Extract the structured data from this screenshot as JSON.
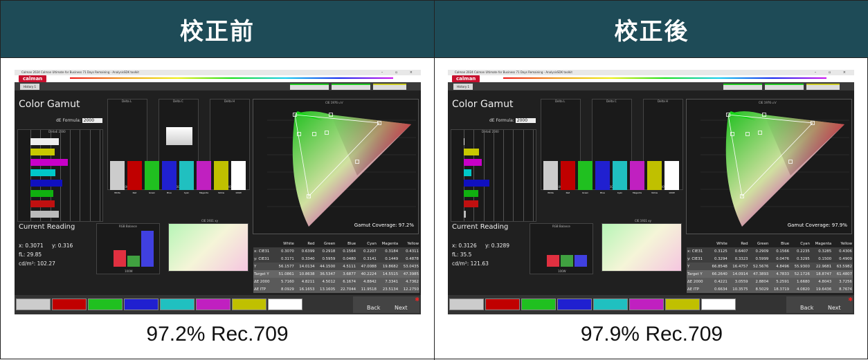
{
  "panels": [
    {
      "id": "before",
      "header": "校正前",
      "caption": "97.2% Rec.709",
      "window_title": "Calman 2024 Calman Ultimate for Business 71 Days Remaining - AnalysisSDK toolkit",
      "app_logo": "calman",
      "tab_label": "History 1",
      "title": "Color Gamut",
      "de_formula_label": "dE Formula:",
      "de_formula_value": "2000",
      "deltae_label": "DeltaE 2000",
      "delta_titles": [
        "Delta L",
        "Delta C",
        "Delta H"
      ],
      "delta_footer": "100W",
      "cie_title": "CIE 1976 u'v'",
      "gamut_coverage": "Gamut Coverage: 97.2%",
      "patch_labels": [
        "White",
        "Red",
        "Green",
        "Blue",
        "Cyan",
        "Magenta",
        "Yellow",
        "100W"
      ],
      "current_reading": "Current Reading",
      "x_label": "x: 0.3071",
      "y_label": "y: 0.316",
      "fl_label": "fL: 29.85",
      "cdm_label": "cd/m²: 102.27",
      "rgb_balance_title": "RGB Balance",
      "cie31_title": "CIE 1931 xy",
      "rgb_balance": {
        "r": 108,
        "g": 98,
        "b": 140,
        "ymin": 80,
        "ymax": 140
      },
      "table": {
        "header": [
          "",
          "White",
          "Red",
          "Green",
          "Blue",
          "Cyan",
          "Magenta",
          "Yellow"
        ],
        "rows": [
          [
            "x: CIE31",
            "0.3070",
            "0.6399",
            "0.2918",
            "0.1564",
            "0.2207",
            "0.3184",
            "0.4311"
          ],
          [
            "y: CIE31",
            "0.3171",
            "0.3340",
            "0.5959",
            "0.0480",
            "0.3141",
            "0.1449",
            "0.4878"
          ],
          [
            "Y",
            "56.1577",
            "14.0134",
            "44.1500",
            "4.5111",
            "47.0088",
            "19.8682",
            "53.0435"
          ],
          [
            "Target Y",
            "51.0861",
            "10.8638",
            "36.5347",
            "3.6877",
            "40.2224",
            "14.5515",
            "47.3985"
          ],
          [
            "ΔE 2000",
            "5.7160",
            "4.8211",
            "4.5012",
            "6.1674",
            "4.8842",
            "7.3341",
            "4.7362"
          ],
          [
            "ΔE ITP",
            "8.0929",
            "16.1653",
            "13.1605",
            "22.7044",
            "11.9518",
            "23.5134",
            "12.2750"
          ]
        ]
      },
      "deltae_bars": [
        {
          "v": 5.8,
          "color": "#eeeeee"
        },
        {
          "v": 4.9,
          "color": "#c8c800"
        },
        {
          "v": 7.6,
          "color": "#c800c8"
        },
        {
          "v": 5.1,
          "color": "#00c8c8"
        },
        {
          "v": 6.4,
          "color": "#1010c0"
        },
        {
          "v": 4.6,
          "color": "#10b010"
        },
        {
          "v": 4.9,
          "color": "#c01010"
        },
        {
          "v": 5.7,
          "color": "#bbbbbb"
        }
      ],
      "nav_back": "Back",
      "nav_next": "Next"
    },
    {
      "id": "after",
      "header": "校正後",
      "caption": "97.9% Rec.709",
      "window_title": "Calman 2024 Calman Ultimate for Business 71 Days Remaining - AnalysisSDK toolkit",
      "app_logo": "calman",
      "tab_label": "History 1",
      "title": "Color Gamut",
      "de_formula_label": "dE Formula:",
      "de_formula_value": "2000",
      "deltae_label": "DeltaE 2000",
      "delta_titles": [
        "Delta L",
        "Delta C",
        "Delta H"
      ],
      "delta_footer": "100W",
      "cie_title": "CIE 1976 u'v'",
      "gamut_coverage": "Gamut Coverage: 97.9%",
      "patch_labels": [
        "White",
        "Red",
        "Green",
        "Blue",
        "Cyan",
        "Magenta",
        "Yellow",
        "100W"
      ],
      "current_reading": "Current Reading",
      "x_label": "x: 0.3126",
      "y_label": "y: 0.3289",
      "fl_label": "fL: 35.5",
      "cdm_label": "cd/m²: 121.63",
      "rgb_balance_title": "RGB Balance",
      "cie31_title": "CIE 1931 xy",
      "rgb_balance": {
        "r": 100,
        "g": 100,
        "b": 100,
        "ymin": 80,
        "ymax": 140
      },
      "table": {
        "header": [
          "",
          "White",
          "Red",
          "Green",
          "Blue",
          "Cyan",
          "Magenta",
          "Yellow"
        ],
        "rows": [
          [
            "x: CIE31",
            "0.3125",
            "0.6407",
            "0.2909",
            "0.1566",
            "0.2235",
            "0.3285",
            "0.4306"
          ],
          [
            "y: CIE31",
            "0.3294",
            "0.3323",
            "0.5999",
            "0.0476",
            "0.3295",
            "0.1500",
            "0.4909"
          ],
          [
            "Y",
            "66.8548",
            "16.4757",
            "52.5676",
            "4.8496",
            "55.9300",
            "22.9681",
            "63.5982"
          ],
          [
            "Target Y",
            "66.2640",
            "14.0914",
            "47.3893",
            "4.7833",
            "52.1726",
            "18.8747",
            "61.4807"
          ],
          [
            "ΔE 2000",
            "0.4221",
            "3.0559",
            "2.8804",
            "5.2591",
            "1.6680",
            "4.8043",
            "3.7256"
          ],
          [
            "ΔE ITP",
            "0.6634",
            "10.3575",
            "8.5029",
            "18.3719",
            "4.0820",
            "19.6436",
            "8.7674"
          ]
        ]
      },
      "deltae_bars": [
        {
          "v": 0,
          "color": "#eeeeee"
        },
        {
          "v": 3.1,
          "color": "#c8c800"
        },
        {
          "v": 3.6,
          "color": "#c800c8"
        },
        {
          "v": 1.6,
          "color": "#00c8c8"
        },
        {
          "v": 5.2,
          "color": "#1010c0"
        },
        {
          "v": 2.9,
          "color": "#10b010"
        },
        {
          "v": 3.0,
          "color": "#c01010"
        },
        {
          "v": 0.4,
          "color": "#bbbbbb"
        }
      ],
      "nav_back": "Back",
      "nav_next": "Next"
    }
  ],
  "patch_colors": [
    "#cccccc",
    "#c00000",
    "#20c020",
    "#2020d0",
    "#20c0c0",
    "#c020c0",
    "#c0c000",
    "#ffffff"
  ]
}
